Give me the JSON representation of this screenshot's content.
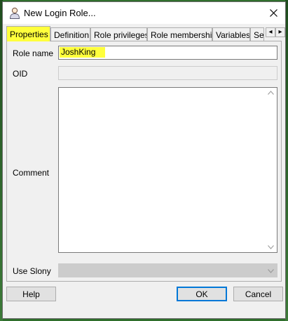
{
  "window": {
    "title": "New Login Role...",
    "close_symbol": "✕"
  },
  "tabs": [
    {
      "label": "Properties",
      "active": true
    },
    {
      "label": "Definition"
    },
    {
      "label": "Role privileges"
    },
    {
      "label": "Role membership"
    },
    {
      "label": "Variables"
    },
    {
      "label": "Se"
    }
  ],
  "tab_scroll": {
    "left": "◂",
    "right": "▸"
  },
  "form": {
    "role_name_label": "Role name",
    "role_name_value": "JoshKing",
    "oid_label": "OID",
    "oid_value": "",
    "comment_label": "Comment",
    "comment_value": "",
    "use_slony_label": "Use Slony",
    "use_slony_value": ""
  },
  "buttons": {
    "help": "Help",
    "ok": "OK",
    "cancel": "Cancel"
  },
  "colors": {
    "highlight": "#ffff3c",
    "default_button_border": "#0078d7"
  },
  "icons": {
    "title": "user-icon",
    "close": "close-icon",
    "scroll_up": "chevron-up-icon",
    "scroll_down": "chevron-down-icon",
    "dropdown": "chevron-down-icon"
  }
}
